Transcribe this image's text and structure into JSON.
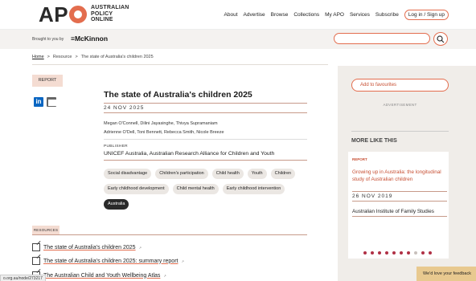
{
  "header": {
    "logo": "APO",
    "logo_sub": [
      "AUSTRALIAN",
      "POLICY",
      "ONLINE"
    ],
    "nav": [
      "About",
      "Advertise",
      "Browse",
      "Collections",
      "My APO",
      "Services",
      "Subscribe"
    ],
    "login": "Log in / Sign up"
  },
  "sponsor": {
    "brought": "Brought to you by",
    "name": "McKinnon"
  },
  "breadcrumb": [
    "Home",
    ">",
    "Resource",
    ">",
    "The state of Australia's children 2025"
  ],
  "report": {
    "badge": "REPORT",
    "title": "The state of Australia's children 2025",
    "date": "24 NOV 2025",
    "authors_line1": "Megan O'Connell, Dilini Jayasinghe, Thivya Supramaniam",
    "authors_line2": "Adrienne O'Dell, Toni Bennett, Rebecca Smith, Nicole Breeze",
    "publisher_label": "PUBLISHER",
    "publishers": "UNICEF Australia, Australian Research Alliance for Children and Youth",
    "tags": [
      "Social disadvantage",
      "Children's participation",
      "Child health",
      "Youth",
      "Children",
      "Early childhood development",
      "Child mental health",
      "Early childhood intervention",
      "Australia"
    ]
  },
  "resources": {
    "badge": "RESOURCES",
    "items": [
      "The state of Australia's children 2025",
      "The state of Australia's children 2025: summary report",
      "The Australian Child and Youth Wellbeing Atlas"
    ]
  },
  "sidebar": {
    "favourites": "Add to favourites",
    "advert": "ADVERTISEMENT",
    "more_like": "MORE LIKE THIS",
    "card": {
      "tag": "REPORT",
      "title": "Growing up in Australia: the longitudinal study of Australian children",
      "date": "26 NOV 2019",
      "publisher": "Australian Institute of Family Studies"
    },
    "feedback": "We'd love your feedback"
  },
  "status_url": "o.org.au/node/273217",
  "colors": {
    "accent": "#e36d4e",
    "tag_dark": "#2a2a2a",
    "dot": "#b03045"
  }
}
